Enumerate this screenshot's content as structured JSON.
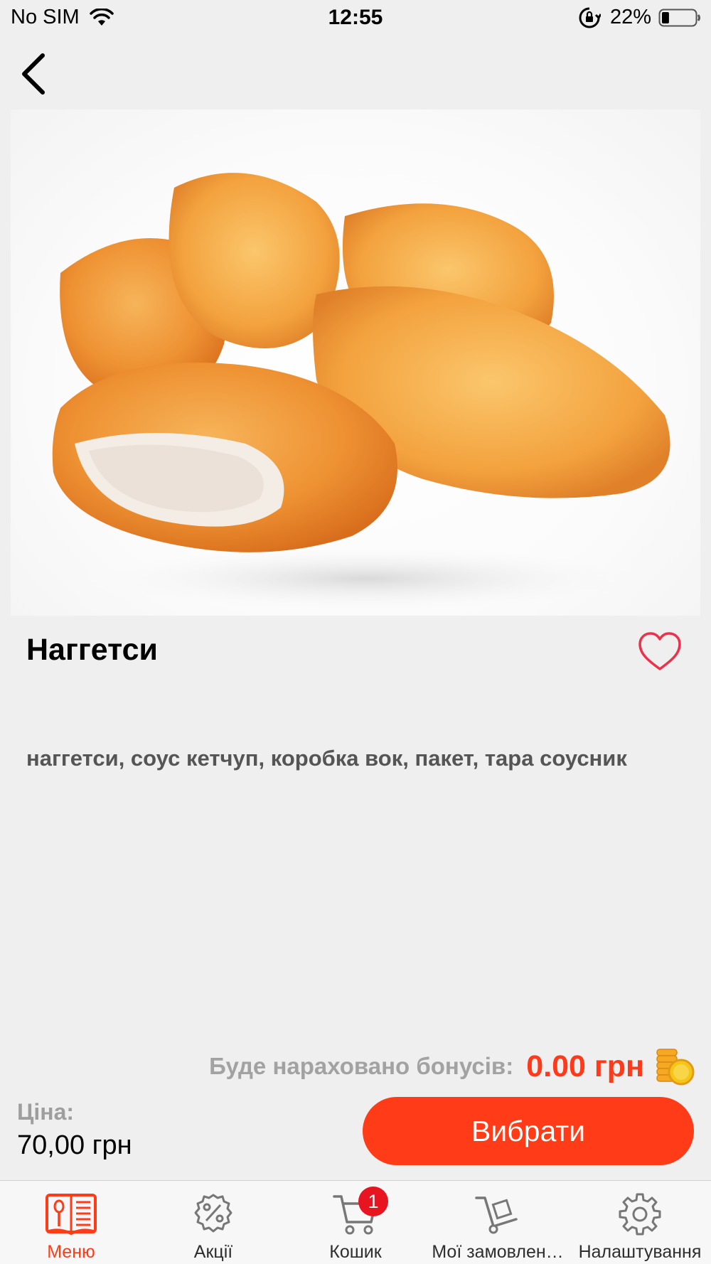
{
  "status_bar": {
    "carrier": "No SIM",
    "time": "12:55",
    "battery_percent": "22%",
    "battery_level": 0.22,
    "icons": [
      "wifi-icon",
      "orientation-lock-icon",
      "battery-icon"
    ]
  },
  "nav": {
    "back_icon": "chevron-left-icon"
  },
  "product": {
    "title": "Наггетси",
    "description": "наггетси, соус кетчуп, коробка вок, пакет, тара соусник",
    "favorite_icon": "heart-outline-icon"
  },
  "bonus": {
    "label": "Буде нараховано бонусів:",
    "value": "0.00 грн",
    "icon": "coins-icon"
  },
  "price": {
    "label": "Ціна:",
    "value": "70,00 грн"
  },
  "actions": {
    "choose_label": "Вибрати"
  },
  "tab_bar": {
    "tabs": [
      {
        "label": "Меню",
        "icon": "menu-book-icon",
        "active": true
      },
      {
        "label": "Акції",
        "icon": "discount-gear-icon",
        "active": false
      },
      {
        "label": "Кошик",
        "icon": "cart-icon",
        "active": false,
        "badge": "1"
      },
      {
        "label": "Мої замовлен…",
        "icon": "hand-truck-icon",
        "active": false
      },
      {
        "label": "Налаштування",
        "icon": "settings-gear-icon",
        "active": false
      }
    ]
  },
  "colors": {
    "accent": "#ff3c17",
    "badge": "#e8141f",
    "heart": "#e8334a",
    "background": "#efefef"
  }
}
